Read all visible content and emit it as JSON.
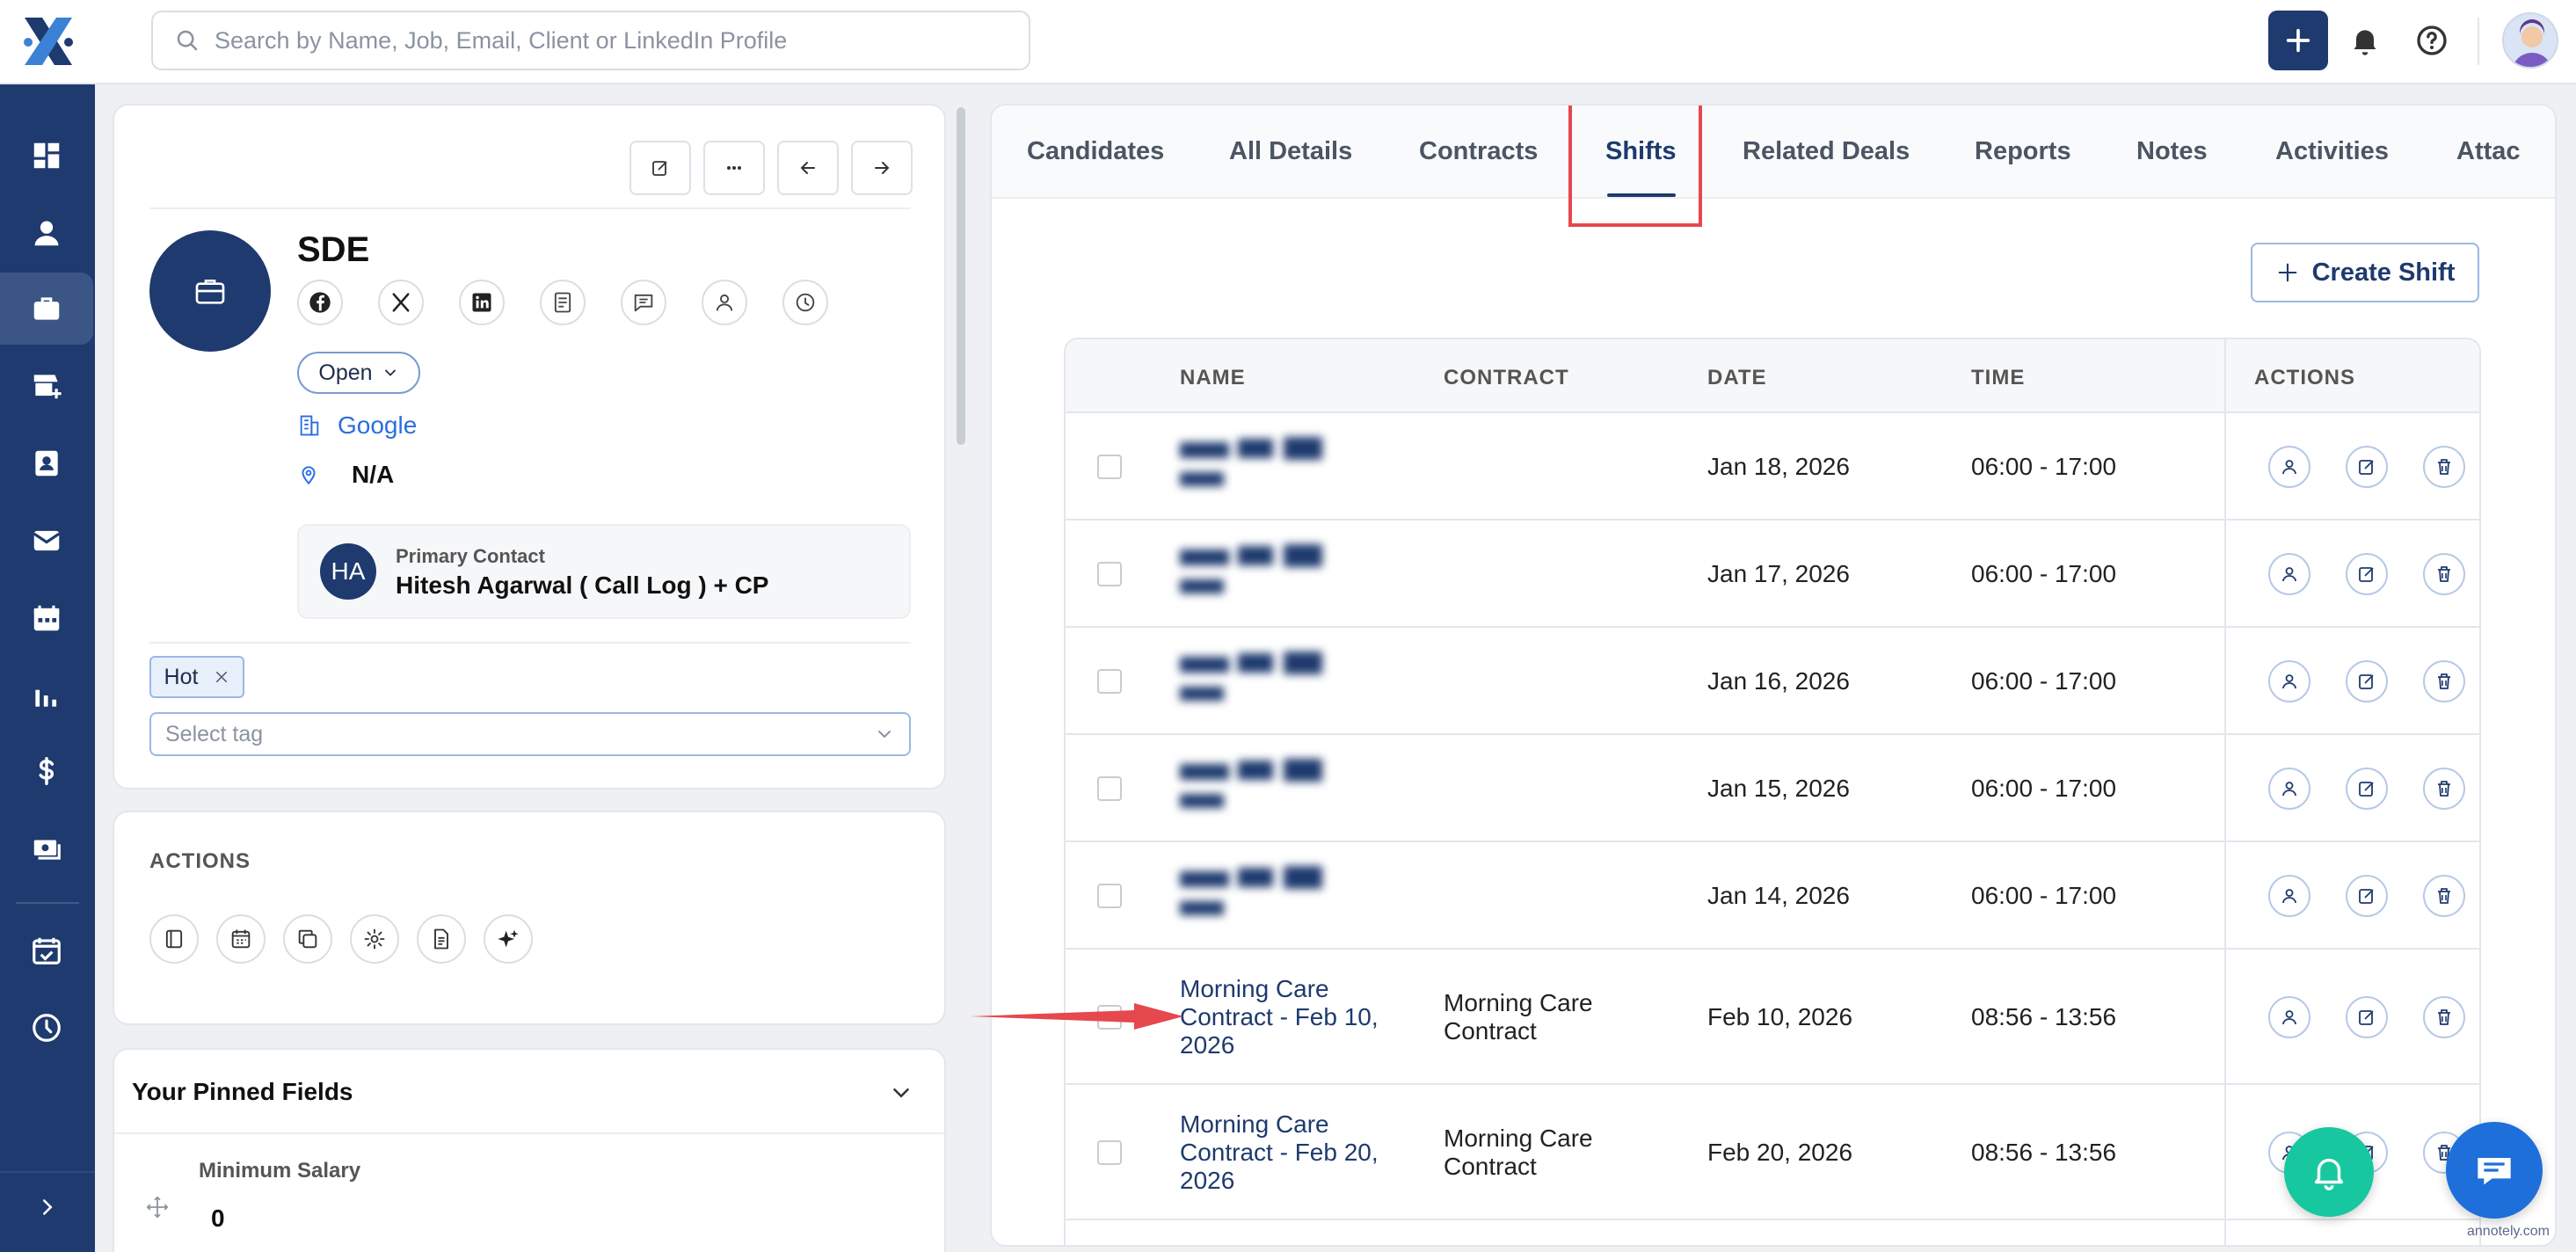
{
  "search": {
    "placeholder": "Search by Name, Job, Email, Client or LinkedIn Profile"
  },
  "job": {
    "title": "SDE",
    "status": "Open",
    "company": "Google",
    "location": "N/A",
    "primary_contact": {
      "label": "Primary Contact",
      "initials": "HA",
      "name": "Hitesh Agarwal ( Call Log ) + CP"
    },
    "tags": [
      "Hot"
    ],
    "tag_placeholder": "Select tag"
  },
  "actions_section": {
    "title": "ACTIONS"
  },
  "pinned": {
    "title": "Your Pinned Fields",
    "field_label": "Minimum Salary",
    "field_value": "0"
  },
  "tabs": [
    "Candidates",
    "All Details",
    "Contracts",
    "Shifts",
    "Related Deals",
    "Reports",
    "Notes",
    "Activities",
    "Attac"
  ],
  "active_tab": "Shifts",
  "create_button": "Create Shift",
  "table": {
    "headers": [
      "NAME",
      "CONTRACT",
      "DATE",
      "TIME",
      "ACTIONS"
    ],
    "rows": [
      {
        "name": "",
        "contract": "",
        "date": "Jan 18, 2026",
        "time": "06:00 - 17:00"
      },
      {
        "name": "",
        "contract": "",
        "date": "Jan 17, 2026",
        "time": "06:00 - 17:00"
      },
      {
        "name": "",
        "contract": "",
        "date": "Jan 16, 2026",
        "time": "06:00 - 17:00"
      },
      {
        "name": "",
        "contract": "",
        "date": "Jan 15, 2026",
        "time": "06:00 - 17:00"
      },
      {
        "name": "",
        "contract": "",
        "date": "Jan 14, 2026",
        "time": "06:00 - 17:00"
      },
      {
        "name": "Morning Care Contract - Feb 10, 2026",
        "contract": "Morning Care Contract",
        "date": "Feb 10, 2026",
        "time": "08:56 - 13:56"
      },
      {
        "name": "Morning Care Contract - Feb 20, 2026",
        "contract": "Morning Care Contract",
        "date": "Feb 20, 2026",
        "time": "08:56 - 13:56"
      }
    ]
  },
  "watermark": "annotely.com",
  "colors": {
    "brand": "#1e3a6e",
    "highlight": "#e5484d",
    "fab_green": "#17c7a0",
    "fab_blue": "#1e6fd9",
    "link": "#2a6ee0"
  }
}
